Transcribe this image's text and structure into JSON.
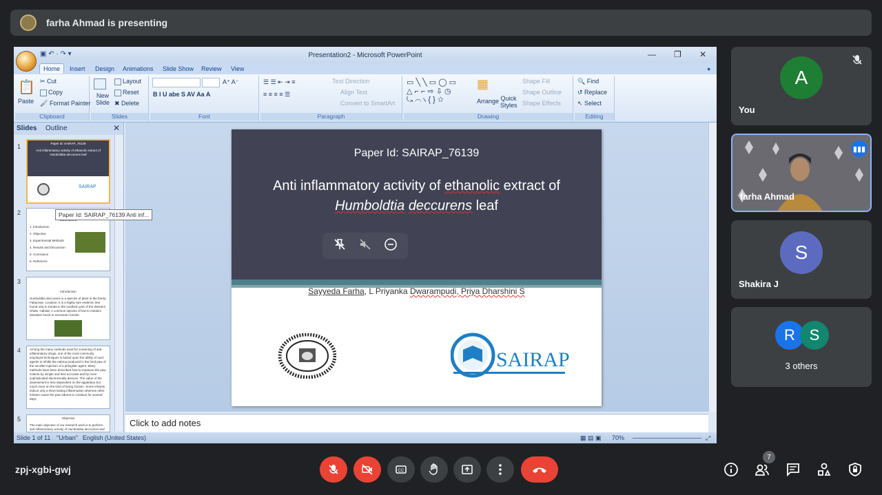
{
  "presenting": {
    "text": "farha Ahmad is presenting"
  },
  "powerpoint": {
    "window_title": "Presentation2 - Microsoft PowerPoint",
    "tabs": [
      "Home",
      "Insert",
      "Design",
      "Animations",
      "Slide Show",
      "Review",
      "View"
    ],
    "ribbon": {
      "clipboard": {
        "paste": "Paste",
        "cut": "Cut",
        "copy": "Copy",
        "format_painter": "Format Painter",
        "label": "Clipboard"
      },
      "slides": {
        "new_slide": "New Slide",
        "layout": "Layout",
        "reset": "Reset",
        "delete": "Delete",
        "label": "Slides"
      },
      "font": {
        "label": "Font"
      },
      "paragraph": {
        "text_direction": "Text Direction",
        "align_text": "Align Text",
        "convert": "Convert to SmartArt",
        "label": "Paragraph"
      },
      "drawing": {
        "arrange": "Arrange",
        "quick_styles": "Quick Styles",
        "shape_fill": "Shape Fill",
        "shape_outline": "Shape Outline",
        "shape_effects": "Shape Effects",
        "label": "Drawing"
      },
      "editing": {
        "find": "Find",
        "replace": "Replace",
        "select": "Select",
        "label": "Editing"
      }
    },
    "pane_tabs": {
      "slides": "Slides",
      "outline": "Outline"
    },
    "thumbnails": [
      {
        "num": "1",
        "title": "Paper Id: SAIRAP_76139",
        "body": "Anti inflammatory activity of ethanolic extract of Humboldtia deccurens leaf"
      },
      {
        "num": "2",
        "title": "CONTENTS",
        "items": [
          "1. Introduction",
          "2. Objective",
          "3. Experimental Methods",
          "4. Results and Discussion",
          "5. Conclusion",
          "6. Reference"
        ]
      },
      {
        "num": "3",
        "title": "Introduction",
        "body": "Humboldtia deccurens is a species of plant in the family Fabaceae. Location: It is a highly rare endemic tree found only in Kerala in the southern part of the Western Ghats. Habitat: A common species of low to medium elevation found in evergreen forests."
      },
      {
        "num": "4",
        "body": "Among the many methods used for screening of anti-inflammatory drugs, one of the most commonly employed techniques is based upon the ability of such agents to inhibit the edema produced in the hind paw of the rat after injection of a phlogistic agent. Many methods have been described how to measure the paw volume by simple and less accurate and by more sophisticated electronically devices. The value of the assessment is less dependent on the apparatus but much more on the kind of being chosen. Some irritants induce only a short lasting inflammation whereas other irritants cause the paw edema to continue for several days."
      },
      {
        "num": "5",
        "title": "Objective",
        "body": "The main objective of our research work is to perform anti inflammatory activity of Humboldtia deccurens leaf"
      }
    ],
    "tooltip": "Paper Id: SAIRAP_76139   Anti inf...",
    "slide": {
      "paper_id": "Paper Id: SAIRAP_76139",
      "title_line1_a": "Anti inflammatory activity of ",
      "title_line1_b": "ethanolic",
      "title_line1_c": " extract of",
      "title_line2_a": "Humboldtia",
      "title_line2_b": "deccurens",
      "title_line2_c": " leaf",
      "authors_a": "Sayyeda Farha",
      "authors_b": ", L Priyanka ",
      "authors_c": "Dwarampudi",
      "authors_d": ", Priya Dharshini S",
      "logo_text": "SAIRAP"
    },
    "notes_placeholder": "Click to add notes",
    "status": {
      "slide": "Slide 1 of 11",
      "theme": "\"Urban\"",
      "language": "English (United States)",
      "zoom": "70%"
    }
  },
  "participants": [
    {
      "name": "You",
      "initial": "A",
      "color": "#1e7e34",
      "muted": true
    },
    {
      "name": "farha Ahmad",
      "speaking": true
    },
    {
      "name": "Shakira J",
      "initial": "S",
      "color": "#5c6bc0"
    },
    {
      "name": "3 others",
      "initials": [
        "R",
        "S"
      ],
      "colors": [
        "#1a73e8",
        "#12866f"
      ]
    }
  ],
  "meeting": {
    "code": "zpj-xgbi-gwj",
    "participant_count": "7",
    "icons": [
      "mic-off-icon",
      "camera-off-icon",
      "captions-icon",
      "raise-hand-icon",
      "present-icon",
      "more-icon",
      "end-call-icon",
      "info-icon",
      "people-icon",
      "chat-icon",
      "activities-icon",
      "host-controls-icon"
    ],
    "colors": {
      "end": "#ea4335",
      "bar": "#3c4043",
      "accent": "#8ab4f8"
    }
  }
}
